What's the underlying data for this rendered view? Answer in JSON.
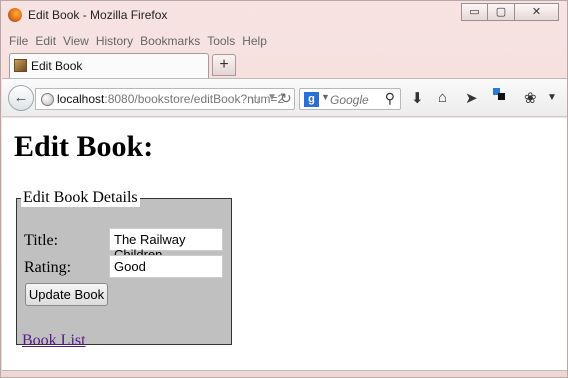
{
  "window": {
    "title": "Edit Book - Mozilla Firefox",
    "controls": {
      "minimize": "▭",
      "maximize": "▢",
      "close": "✕"
    }
  },
  "menu": [
    "File",
    "Edit",
    "View",
    "History",
    "Bookmarks",
    "Tools",
    "Help"
  ],
  "tabs": [
    {
      "label": "Edit Book"
    }
  ],
  "newtab_label": "+",
  "navbar": {
    "url_host": "localhost",
    "url_rest": ":8080/bookstore/editBook?num=2",
    "search_placeholder": "Google",
    "search_engine_letter": "g"
  },
  "page": {
    "heading": "Edit Book:",
    "fieldset_legend": "Edit Book Details",
    "title_label": "Title:",
    "title_value": "The Railway Children",
    "rating_label": "Rating:",
    "rating_value": "Good",
    "update_button": "Update Book",
    "book_list_link": "Book List"
  },
  "icons": [
    "firefox-icon",
    "back-arrow-icon",
    "globe-icon",
    "star-icon",
    "reload-icon",
    "search-icon",
    "download-icon",
    "home-icon",
    "share-icon",
    "app-icon",
    "plugin-icon"
  ]
}
